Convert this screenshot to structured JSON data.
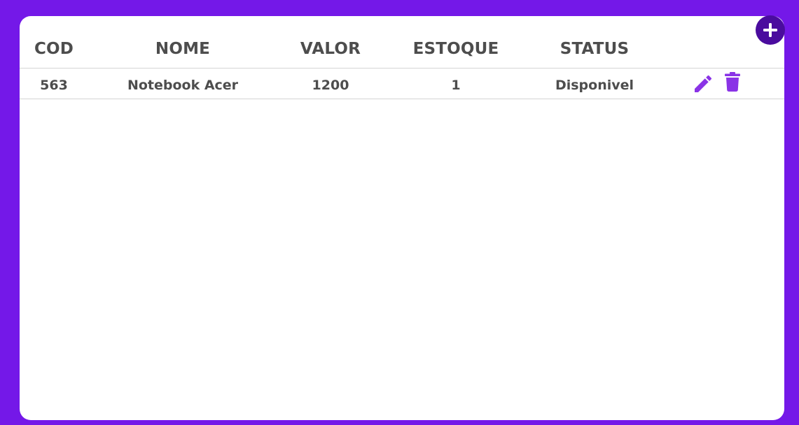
{
  "colors": {
    "background": "#7418e8",
    "card": "#ffffff",
    "add_button": "#4a0c9e",
    "action_icon": "#8a33e6",
    "text": "#4d4d4d",
    "divider": "#d4d4d4"
  },
  "toolbar": {
    "add_button_icon": "plus-icon"
  },
  "table": {
    "headers": {
      "cod": "COD",
      "nome": "NOME",
      "valor": "VALOR",
      "estoque": "ESTOQUE",
      "status": "STATUS"
    },
    "rows": [
      {
        "cod": "563",
        "nome": "Notebook Acer",
        "valor": "1200",
        "estoque": "1",
        "status": "Disponivel",
        "actions": [
          "pencil-icon",
          "trash-icon"
        ]
      }
    ]
  }
}
